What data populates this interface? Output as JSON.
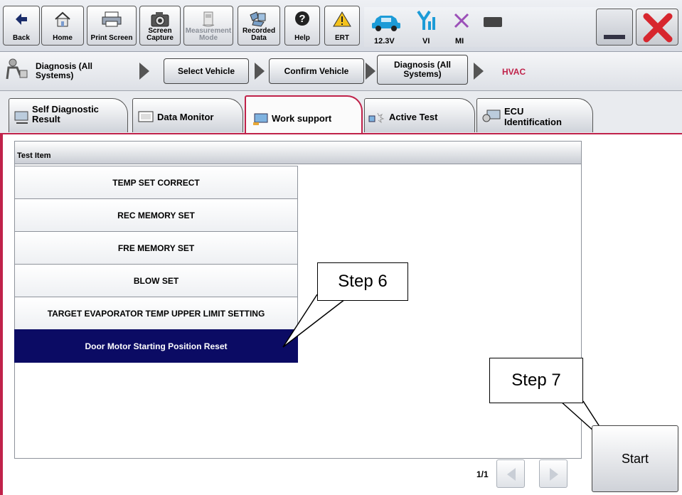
{
  "toolbar": {
    "buttons": [
      {
        "label": "Back",
        "icon": "back-arrow-icon"
      },
      {
        "label": "Home",
        "icon": "home-icon"
      },
      {
        "label": "Print Screen",
        "icon": "printer-icon"
      },
      {
        "label": "Screen Capture",
        "icon": "camera-icon"
      },
      {
        "label": "Measurement Mode",
        "icon": "measurement-icon"
      },
      {
        "label": "Recorded Data",
        "icon": "recorded-data-icon"
      },
      {
        "label": "Help",
        "icon": "help-icon"
      },
      {
        "label": "ERT",
        "icon": "warning-icon"
      }
    ],
    "status": {
      "battery": "12.3V",
      "vi": "VI",
      "mi": "MI"
    }
  },
  "breadcrumb": {
    "root": "Diagnosis (All Systems)",
    "steps": [
      "Select Vehicle",
      "Confirm Vehicle",
      "Diagnosis (All Systems)"
    ],
    "current": "HVAC"
  },
  "tabs": [
    {
      "label": "Self Diagnostic Result",
      "icon": "self-diagnostic-icon"
    },
    {
      "label": "Data Monitor",
      "icon": "data-monitor-icon"
    },
    {
      "label": "Work support",
      "icon": "work-support-icon",
      "active": true
    },
    {
      "label": "Active Test",
      "icon": "active-test-icon"
    },
    {
      "label": "ECU Identification",
      "icon": "ecu-identification-icon"
    }
  ],
  "test_list": {
    "header": "Test Item",
    "items": [
      {
        "label": "TEMP SET CORRECT"
      },
      {
        "label": "REC MEMORY SET"
      },
      {
        "label": "FRE MEMORY SET"
      },
      {
        "label": "BLOW SET"
      },
      {
        "label": "TARGET EVAPORATOR TEMP UPPER LIMIT SETTING"
      },
      {
        "label": "Door Motor Starting Position Reset",
        "selected": true
      }
    ]
  },
  "pagination": {
    "page": "1/1"
  },
  "start_label": "Start",
  "callouts": {
    "step6": "Step 6",
    "step7": "Step 7"
  },
  "colors": {
    "accent": "#c0224a",
    "selected_row": "#0b0b64"
  }
}
